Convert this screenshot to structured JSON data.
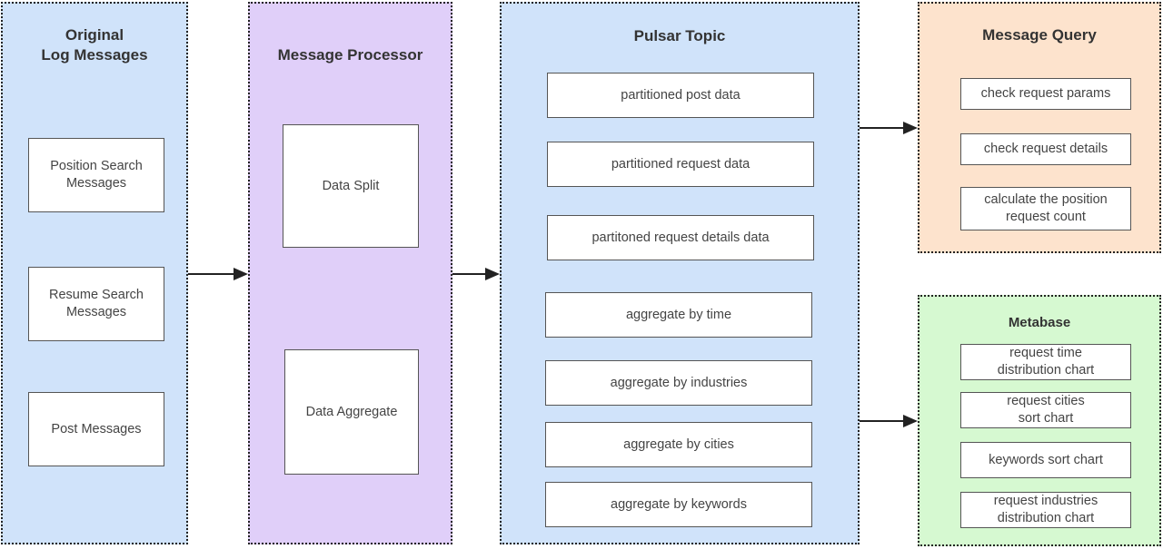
{
  "groups": {
    "original_log": {
      "title": "Original\nLog Messages",
      "fill": "#d0e3fa",
      "items": [
        "Position Search\nMessages",
        "Resume Search\nMessages",
        "Post Messages"
      ]
    },
    "message_processor": {
      "title": "Message Processor",
      "fill": "#e0cff9",
      "items": [
        "Data Split",
        "Data Aggregate"
      ]
    },
    "pulsar_topic": {
      "title": "Pulsar Topic",
      "fill": "#d0e3fa",
      "items": [
        "partitioned post data",
        "partitioned request data",
        "partitoned request details data",
        "aggregate by time",
        "aggregate by industries",
        "aggregate by cities",
        "aggregate by keywords"
      ]
    },
    "message_query": {
      "title": "Message Query",
      "fill": "#fde3cd",
      "items": [
        "check request params",
        "check request details",
        "calculate the position\nrequest count"
      ]
    },
    "metabase": {
      "title": "Metabase",
      "fill": "#d6f9d1",
      "items": [
        "request time\ndistribution chart",
        "request cities\nsort chart",
        "keywords sort chart",
        "request industries\ndistribution chart"
      ]
    }
  },
  "edges": [
    {
      "from": "Original Log Messages",
      "to": "Message Processor"
    },
    {
      "from": "Message Processor",
      "to": "Pulsar Topic"
    },
    {
      "from": "Pulsar Topic",
      "to": "Message Query"
    },
    {
      "from": "Pulsar Topic",
      "to": "Metabase"
    }
  ]
}
